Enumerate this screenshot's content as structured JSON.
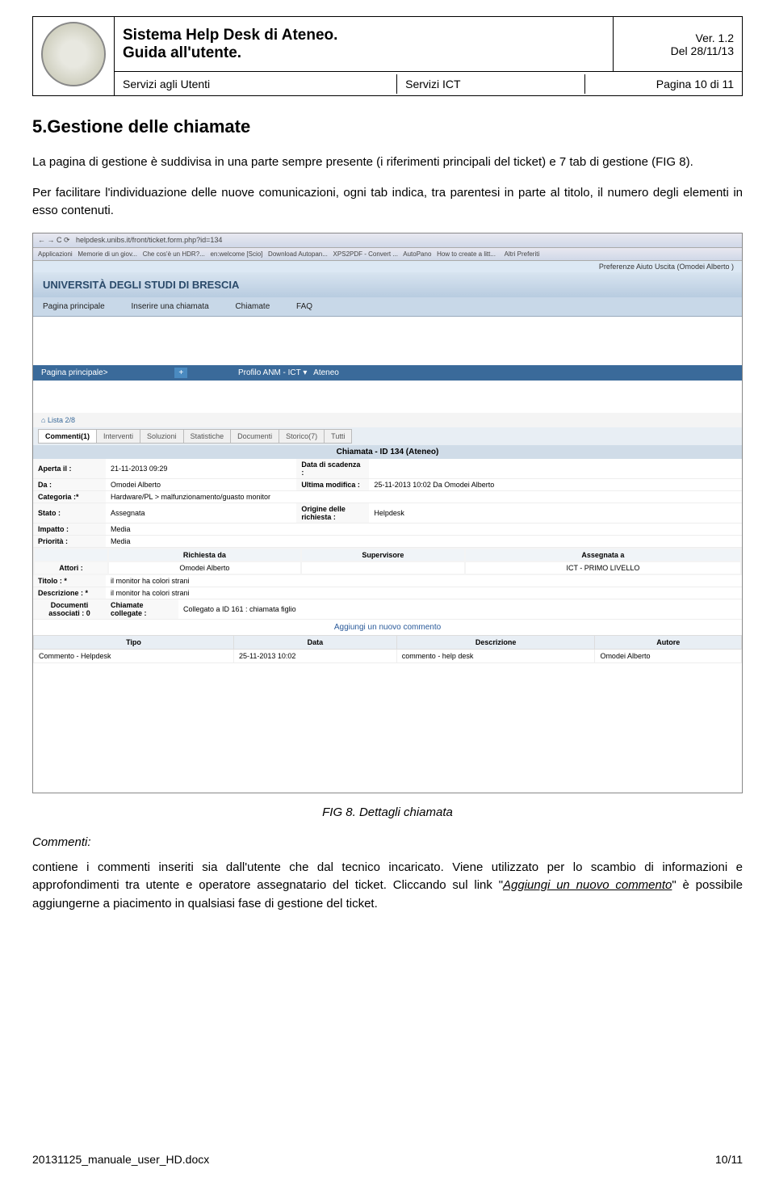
{
  "header": {
    "title_line1": "Sistema Help Desk di Ateneo.",
    "title_line2": "Guida all'utente.",
    "version_line1": "Ver. 1.2",
    "version_line2": "Del 28/11/13",
    "sub_left": "Servizi agli Utenti",
    "sub_mid": "Servizi ICT",
    "sub_right": "Pagina 10 di 11"
  },
  "heading": "5.Gestione delle chiamate",
  "para1": "La pagina di gestione è suddivisa in una parte sempre presente (i riferimenti principali del ticket) e 7 tab di gestione  (FIG 8).",
  "para2": "Per facilitare l'individuazione delle nuove comunicazioni, ogni tab indica, tra parentesi in parte al titolo, il numero degli elementi in esso contenuti.",
  "screenshot": {
    "url": "helpdesk.unibs.it/front/ticket.form.php?id=134",
    "uni_name": "UNIVERSITÀ DEGLI STUDI DI BRESCIA",
    "top_links": "Preferenze    Aiuto    Uscita (Omodei Alberto )",
    "nav": {
      "home": "Pagina principale",
      "insert": "Inserire una chiamata",
      "calls": "Chiamate",
      "faq": "FAQ"
    },
    "breadcrumb": "Pagina principale>",
    "list_nav": "Lista   2/8",
    "inner_tabs": [
      "Commenti(1)",
      "Interventi",
      "Soluzioni",
      "Statistiche",
      "Documenti",
      "Storico(7)",
      "Tutti"
    ],
    "ticket_title": "Chiamata - ID 134 (Ateneo)",
    "fields": {
      "aperta_label": "Aperta il :",
      "aperta_val": "21-11-2013 09:29",
      "scadenza_label": "Data di scadenza :",
      "da_label": "Da :",
      "da_val": "Omodei Alberto",
      "ultima_label": "Ultima modifica :",
      "ultima_val": "25-11-2013 10:02 Da Omodei Alberto",
      "categoria_label": "Categoria :*",
      "categoria_val": "Hardware/PL > malfunzionamento/guasto monitor",
      "stato_label": "Stato :",
      "stato_val": "Assegnata",
      "origine_label": "Origine delle richiesta :",
      "origine_val": "Helpdesk",
      "impatto_label": "Impatto :",
      "impatto_val": "Media",
      "priorita_label": "Priorità :",
      "priorita_val": "Media",
      "richiesta_da": "Richiesta da",
      "supervisore": "Supervisore",
      "assegnata_a": "Assegnata a",
      "attori_label": "Attori :",
      "attori_val": "Omodei Alberto",
      "assegnata_val": "ICT - PRIMO LIVELLO",
      "titolo_label": "Titolo : *",
      "titolo_val": "il monitor ha colori strani",
      "descr_label": "Descrizione : *",
      "descr_val": "il monitor ha colori strani",
      "docs_label": "Documenti associati : 0",
      "collegate_label": "Chiamate collegate :",
      "collegate_val": "Collegato a ID 161 : chiamata figlio"
    },
    "add_comment": "Aggiungi un nuovo commento",
    "comment_headers": {
      "tipo": "Tipo",
      "data": "Data",
      "descr": "Descrizione",
      "autore": "Autore"
    },
    "comment_row": {
      "tipo": "Commento - Helpdesk",
      "data": "25-11-2013 10:02",
      "descr": "commento - help desk",
      "autore": "Omodei Alberto"
    }
  },
  "caption": "FIG 8.    Dettagli chiamata",
  "commenti_label": "Commenti:",
  "para3_part1": "contiene i commenti inseriti sia dall'utente che dal tecnico incaricato. Viene utilizzato per lo scambio di informazioni e approfondimenti tra utente e operatore assegnatario del ticket. Cliccando sul link \"",
  "para3_link": "Aggiungi un nuovo commento",
  "para3_part2": "\" è possibile aggiungerne a piacimento in qualsiasi fase di gestione del ticket.",
  "footer_left": "20131125_manuale_user_HD.docx",
  "footer_right": "10/11"
}
